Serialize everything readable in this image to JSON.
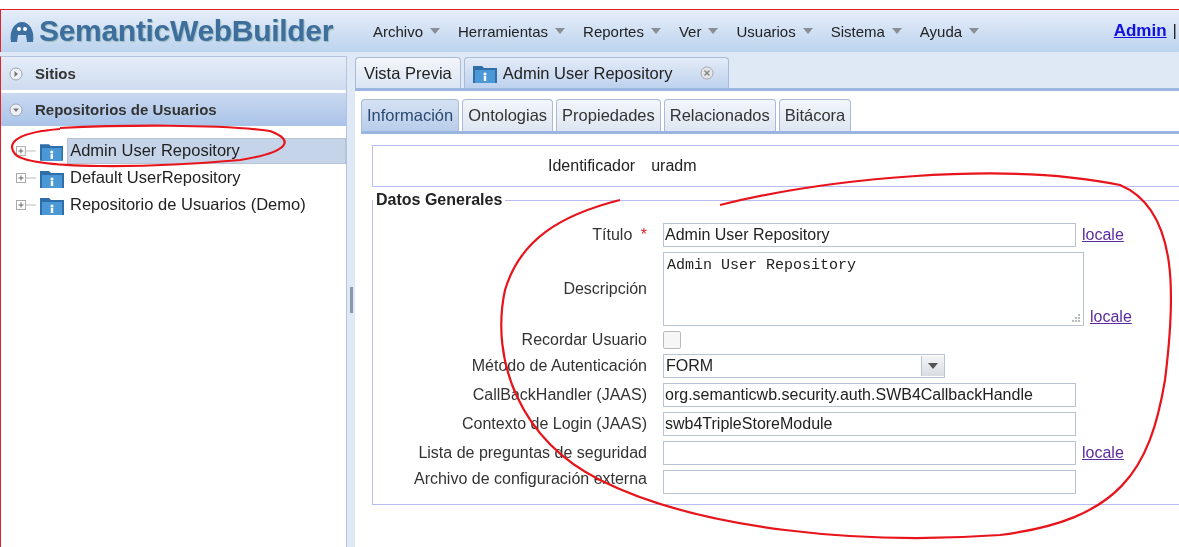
{
  "app": {
    "logo_text": "SemanticWebBuilder"
  },
  "menu": [
    {
      "label": "Archivo"
    },
    {
      "label": "Herramientas"
    },
    {
      "label": "Reportes"
    },
    {
      "label": "Ver"
    },
    {
      "label": "Usuarios"
    },
    {
      "label": "Sistema"
    },
    {
      "label": "Ayuda"
    }
  ],
  "user": {
    "link": "Admin",
    "separator": "|"
  },
  "sidebar": {
    "sections": [
      {
        "title": "Sitios",
        "expanded": false
      },
      {
        "title": "Repositorios de Usuarios",
        "expanded": true
      }
    ],
    "tree": [
      {
        "label": "Admin User Repository",
        "selected": true
      },
      {
        "label": "Default UserRepository",
        "selected": false
      },
      {
        "label": "Repositorio de Usuarios (Demo)",
        "selected": false
      }
    ]
  },
  "tabs": [
    {
      "label": "Vista Previa",
      "selected": false,
      "icon": false,
      "closable": false
    },
    {
      "label": "Admin User Repository",
      "selected": true,
      "icon": true,
      "closable": true
    }
  ],
  "subtabs": [
    {
      "label": "Información",
      "selected": true
    },
    {
      "label": "Ontologias",
      "selected": false
    },
    {
      "label": "Propiedades",
      "selected": false
    },
    {
      "label": "Relacionados",
      "selected": false
    },
    {
      "label": "Bitácora",
      "selected": false
    }
  ],
  "identifier": {
    "label": "Identificador",
    "value": "uradm"
  },
  "fieldset": {
    "legend": "Datos Generales",
    "required_mark": "*",
    "fields": [
      {
        "kind": "text",
        "label": "Título",
        "required": true,
        "value": "Admin User Repository",
        "locale": "locale"
      },
      {
        "kind": "textarea",
        "label": "Descripción",
        "required": false,
        "value": "Admin User Repository",
        "locale": "locale"
      },
      {
        "kind": "checkbox",
        "label": "Recordar Usuario",
        "required": false,
        "checked": false
      },
      {
        "kind": "select",
        "label": "Método de Autenticación",
        "required": false,
        "value": "FORM"
      },
      {
        "kind": "text",
        "label": "CallBackHandler (JAAS)",
        "required": false,
        "value": "org.semanticwb.security.auth.SWB4CallbackHandle"
      },
      {
        "kind": "text",
        "label": "Contexto de Login (JAAS)",
        "required": false,
        "value": "swb4TripleStoreModule"
      },
      {
        "kind": "text",
        "label": "Lista de preguntas de seguridad",
        "required": false,
        "locale": "locale"
      },
      {
        "kind": "text",
        "label": "Archivo de configuración externa",
        "required": false
      }
    ]
  },
  "annotations": [
    {
      "kind": "circle"
    },
    {
      "kind": "circle"
    }
  ]
}
